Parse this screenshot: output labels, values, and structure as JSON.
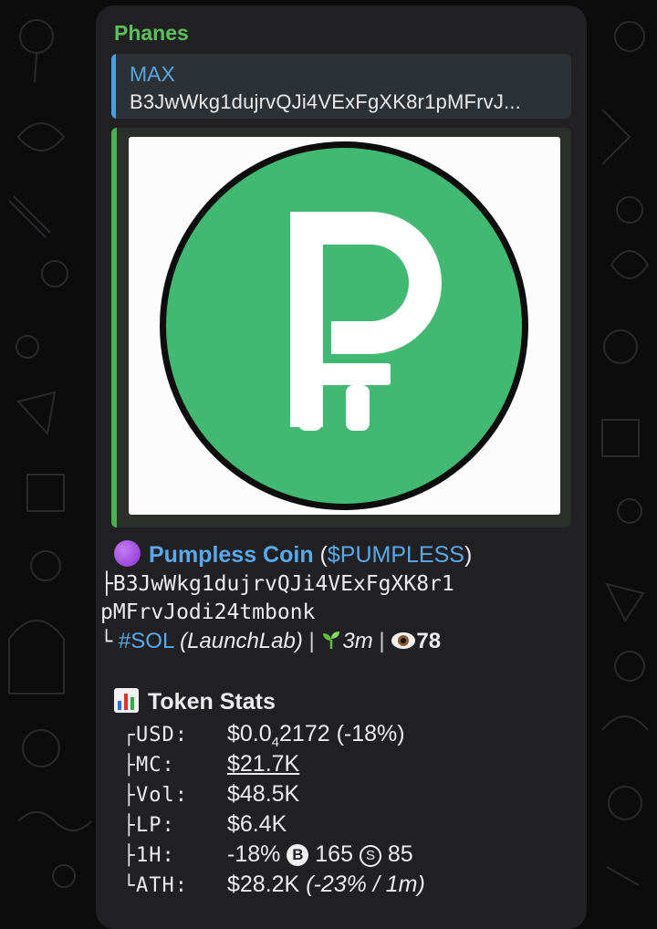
{
  "chat": {
    "sender": "Phanes",
    "reply": {
      "name": "MAX",
      "text": "B3JwWkg1dujrvQJi4VExFgXK8r1pMFrvJ..."
    },
    "preview": {
      "logo_letter": "P",
      "logo_color": "#41b972"
    }
  },
  "token": {
    "emoji": "purple-circle-icon",
    "name": "Pumpless Coin",
    "open_paren": "(",
    "symbol": "$PUMPLESS",
    "close_paren": ")",
    "ca_prefix": "├",
    "ca_line1": "B3JwWkg1dujrvQJi4VExFgXK8r1",
    "ca_line2": "pMFrvJodi24tmbonk",
    "meta_prefix": "└",
    "chain": "#SOL",
    "launchpad": "(LaunchLab)",
    "sep1": " | ",
    "age_icon": "seedling-icon",
    "age": "3m",
    "sep2": " | ",
    "views_icon": "eye-icon",
    "views": "78"
  },
  "stats": {
    "title": "Token Stats",
    "icon": "bar-chart-icon",
    "rows": [
      {
        "tree": "┌",
        "label": "USD:",
        "value_a": "$0.0",
        "value_sub": "4",
        "value_b": "2172 (-18%)"
      },
      {
        "tree": "├",
        "label": "MC:",
        "value": "$21.7K"
      },
      {
        "tree": "├",
        "label": "Vol:",
        "value": "$48.5K"
      },
      {
        "tree": "├",
        "label": "LP:",
        "value": "$6.4K"
      },
      {
        "tree": "├",
        "label": "1H:",
        "change": "-18%",
        "buy_icon": "B",
        "buys": "165",
        "sell_icon": "S",
        "sells": "85"
      },
      {
        "tree": "└",
        "label": "ATH:",
        "value": "$28.2K",
        "ath_note": "(-23% / 1m)"
      }
    ]
  }
}
